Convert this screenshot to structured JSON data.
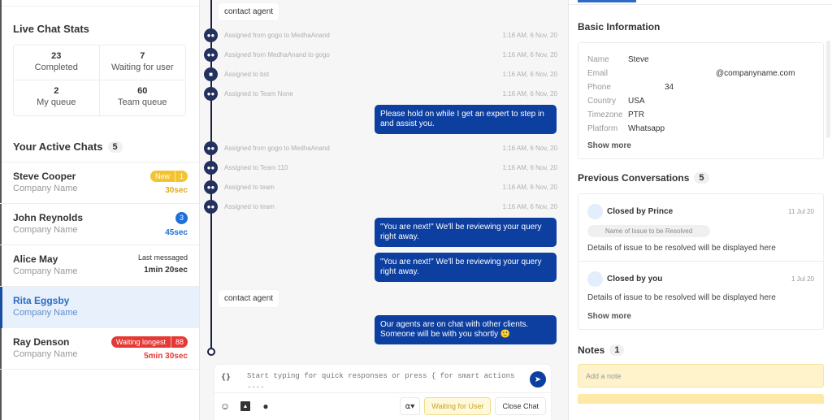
{
  "stats": {
    "title": "Live Chat Stats",
    "items": [
      {
        "value": "23",
        "label": "Completed"
      },
      {
        "value": "7",
        "label": "Waiting for user"
      },
      {
        "value": "2",
        "label": "My queue"
      },
      {
        "value": "60",
        "label": "Team queue"
      }
    ]
  },
  "active_chats": {
    "title": "Your Active Chats",
    "count": "5",
    "items": [
      {
        "name": "Steve Cooper",
        "company": "Company Name",
        "badge_label": "New",
        "badge_count": "1",
        "time": "30sec"
      },
      {
        "name": "John Reynolds",
        "company": "Company Name",
        "badge_count": "3",
        "time": "45sec"
      },
      {
        "name": "Alice May",
        "company": "Company Name",
        "label": "Last messaged",
        "time": "1min 20sec"
      },
      {
        "name": "Rita Eggsby",
        "company": "Company Name"
      },
      {
        "name": "Ray Denson",
        "company": "Company Name",
        "badge_label": "Waiting longest",
        "badge_count": "88",
        "time": "5min 30sec"
      }
    ]
  },
  "conversation": {
    "messages": [
      {
        "type": "user",
        "text": "contact agent"
      },
      {
        "type": "event",
        "icon": "team-icon",
        "text": "Assigned from gogo to MedhaAnand",
        "time": "1:16 AM, 6 Nov, 20"
      },
      {
        "type": "event",
        "icon": "team-icon",
        "text": "Assigned from MedhaAnand to gogo",
        "time": "1:16 AM, 6 Nov, 20"
      },
      {
        "type": "event",
        "icon": "bot-icon",
        "text": "Assigned to bot",
        "time": "1:16 AM, 6 Nov, 20"
      },
      {
        "type": "event",
        "icon": "team-icon",
        "text": "Assigned to Team None",
        "time": "1:16 AM, 6 Nov, 20"
      },
      {
        "type": "bot",
        "text": "Please hold on while I get an expert to step in and assist you."
      },
      {
        "type": "event",
        "icon": "team-icon",
        "text": "Assigned from gogo to MedhaAnand",
        "time": "1:16 AM, 6 Nov, 20"
      },
      {
        "type": "event",
        "icon": "team-icon",
        "text": "Assigned to Team 110",
        "time": "1:16 AM, 6 Nov, 20"
      },
      {
        "type": "event",
        "icon": "team-icon",
        "text": "Assigned to team",
        "time": "1:16 AM, 6 Nov, 20"
      },
      {
        "type": "event",
        "icon": "team-icon",
        "text": "Assigned to team",
        "time": "1:16 AM, 6 Nov, 20"
      },
      {
        "type": "bot",
        "text": "\"You are next!\" We'll be reviewing your query right away."
      },
      {
        "type": "bot",
        "text": "\"You are next!\" We'll be reviewing your query right away."
      },
      {
        "type": "user",
        "text": "contact agent"
      },
      {
        "type": "bot",
        "text": "Our agents are on chat with other clients. Someone will be with you shortly 🙂"
      }
    ]
  },
  "composer": {
    "braces": "{}",
    "placeholder": "Start typing for quick responses or press { for smart actions ....",
    "waiting_label": "Waiting for User",
    "close_label": "Close Chat"
  },
  "basic_info": {
    "title": "Basic Information",
    "rows": [
      {
        "key": "Name",
        "value": "Steve"
      },
      {
        "key": "Email",
        "value": "@companyname.com"
      },
      {
        "key": "Phone",
        "value": "34"
      },
      {
        "key": "Country",
        "value": "USA"
      },
      {
        "key": "Timezone",
        "value": "PTR"
      },
      {
        "key": "Platform",
        "value": "Whatsapp"
      }
    ],
    "show_more": "Show more"
  },
  "previous_conversations": {
    "title": "Previous Conversations",
    "count": "5",
    "items": [
      {
        "by": "Closed by Prince",
        "date": "11 Jul 20",
        "issue": "Name of Issue to be Resolved",
        "details": "Details of issue to be resolved will be displayed here"
      },
      {
        "by": "Closed by you",
        "date": "1 Jul 20",
        "details": "Details of issue to be resolved will be displayed here",
        "show_more": "Show more"
      }
    ]
  },
  "notes": {
    "title": "Notes",
    "count": "1",
    "placeholder": "Add a note"
  }
}
